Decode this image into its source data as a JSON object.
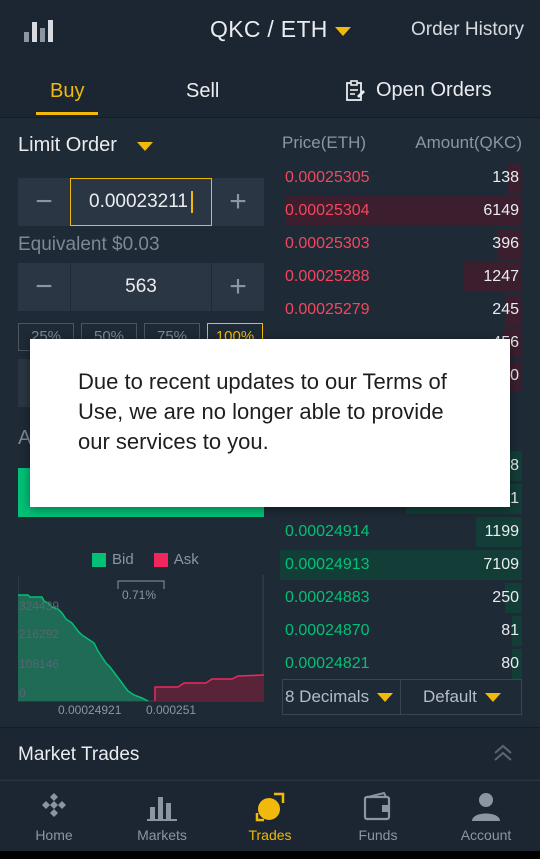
{
  "header": {
    "pair": "QKC / ETH",
    "order_history": "Order History"
  },
  "tabs": {
    "buy": "Buy",
    "sell": "Sell",
    "open_orders": "Open Orders"
  },
  "order_form": {
    "order_type": "Limit Order",
    "price_value": "0.00023211",
    "equivalent": "Equivalent $0.03",
    "amount_value": "563",
    "percent_options": [
      "25%",
      "50%",
      "75%",
      "100%"
    ],
    "selected_percent": "100%",
    "cut_label": "A"
  },
  "depth_chart": {
    "legend_bid": "Bid",
    "legend_ask": "Ask",
    "spread": "0.71%",
    "y_ticks": [
      "324439",
      "216292",
      "108146",
      "0"
    ],
    "x_ticks": [
      "0.00024921",
      "0.000251"
    ],
    "colors": {
      "bid": "#02c076",
      "ask": "#f0265f"
    }
  },
  "order_book": {
    "price_header": "Price(ETH)",
    "amount_header": "Amount(QKC)",
    "asks": [
      {
        "price": "0.00025305",
        "amount": "138",
        "depth": 0.06
      },
      {
        "price": "0.00025304",
        "amount": "6149",
        "depth": 0.98
      },
      {
        "price": "0.00025303",
        "amount": "396",
        "depth": 0.1
      },
      {
        "price": "0.00025288",
        "amount": "1247",
        "depth": 0.24
      },
      {
        "price": "0.00025279",
        "amount": "245",
        "depth": 0.07
      },
      {
        "price": "",
        "amount": "456",
        "depth": 0.08
      },
      {
        "price": "",
        "amount": "0",
        "depth": 0.05
      }
    ],
    "bids": [
      {
        "price": "",
        "amount": "8",
        "depth": 0.05
      },
      {
        "price": "",
        "amount": "1",
        "depth": 0.48
      },
      {
        "price": "0.00024914",
        "amount": "1199",
        "depth": 0.19
      },
      {
        "price": "0.00024913",
        "amount": "7109",
        "depth": 1.0
      },
      {
        "price": "0.00024883",
        "amount": "250",
        "depth": 0.07
      },
      {
        "price": "0.00024870",
        "amount": "81",
        "depth": 0.04
      },
      {
        "price": "0.00024821",
        "amount": "80",
        "depth": 0.04
      }
    ],
    "decimals": "8 Decimals",
    "view": "Default"
  },
  "market_trades": {
    "label": "Market Trades"
  },
  "bottom_nav": [
    {
      "label": "Home",
      "icon": "home-icon"
    },
    {
      "label": "Markets",
      "icon": "markets-icon"
    },
    {
      "label": "Trades",
      "icon": "trades-icon"
    },
    {
      "label": "Funds",
      "icon": "funds-icon"
    },
    {
      "label": "Account",
      "icon": "account-icon"
    }
  ],
  "modal": {
    "message": "Due to recent updates to our Terms of Use, we are no longer able to provide our services to you."
  },
  "colors": {
    "accent": "#f0b90b",
    "buy": "#02c076",
    "sell": "#f6465d",
    "background": "#1e2a36"
  }
}
